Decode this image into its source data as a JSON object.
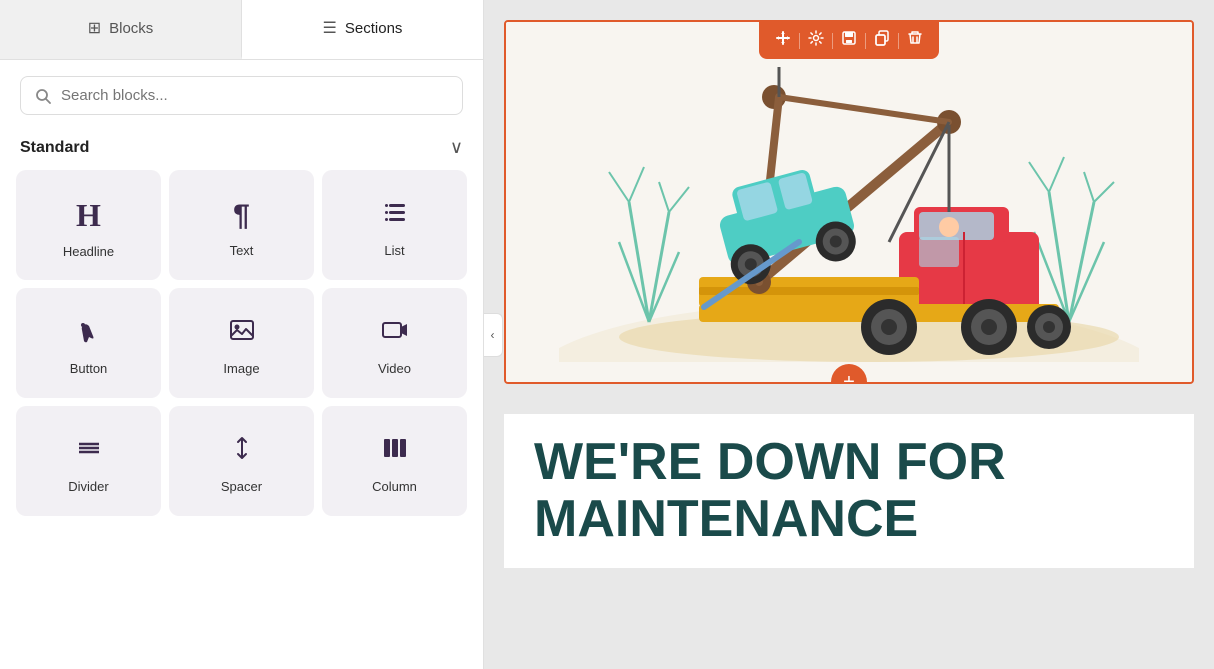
{
  "tabs": [
    {
      "id": "blocks",
      "label": "Blocks",
      "icon": "⊞",
      "active": false
    },
    {
      "id": "sections",
      "label": "Sections",
      "icon": "☰",
      "active": true
    }
  ],
  "search": {
    "placeholder": "Search blocks..."
  },
  "standard": {
    "title": "Standard",
    "chevron": "∨"
  },
  "blocks": [
    {
      "id": "headline",
      "label": "Headline",
      "icon": "H"
    },
    {
      "id": "text",
      "label": "Text",
      "icon": "¶"
    },
    {
      "id": "list",
      "label": "List",
      "icon": "≡"
    },
    {
      "id": "button",
      "label": "Button",
      "icon": "☝"
    },
    {
      "id": "image",
      "label": "Image",
      "icon": "▦"
    },
    {
      "id": "video",
      "label": "Video",
      "icon": "▶"
    },
    {
      "id": "divider",
      "label": "Divider",
      "icon": "—"
    },
    {
      "id": "spacer",
      "label": "Spacer",
      "icon": "⇕"
    },
    {
      "id": "column",
      "label": "Column",
      "icon": "|||"
    }
  ],
  "toolbar": {
    "move_icon": "✦",
    "settings_icon": "⚙",
    "save_icon": "💾",
    "copy_icon": "⧉",
    "delete_icon": "🗑"
  },
  "preview": {
    "maintenance_heading_line1": "WE'RE DOWN FOR",
    "maintenance_heading_line2": "MAINTENANCE"
  },
  "collapse_btn_label": "‹"
}
